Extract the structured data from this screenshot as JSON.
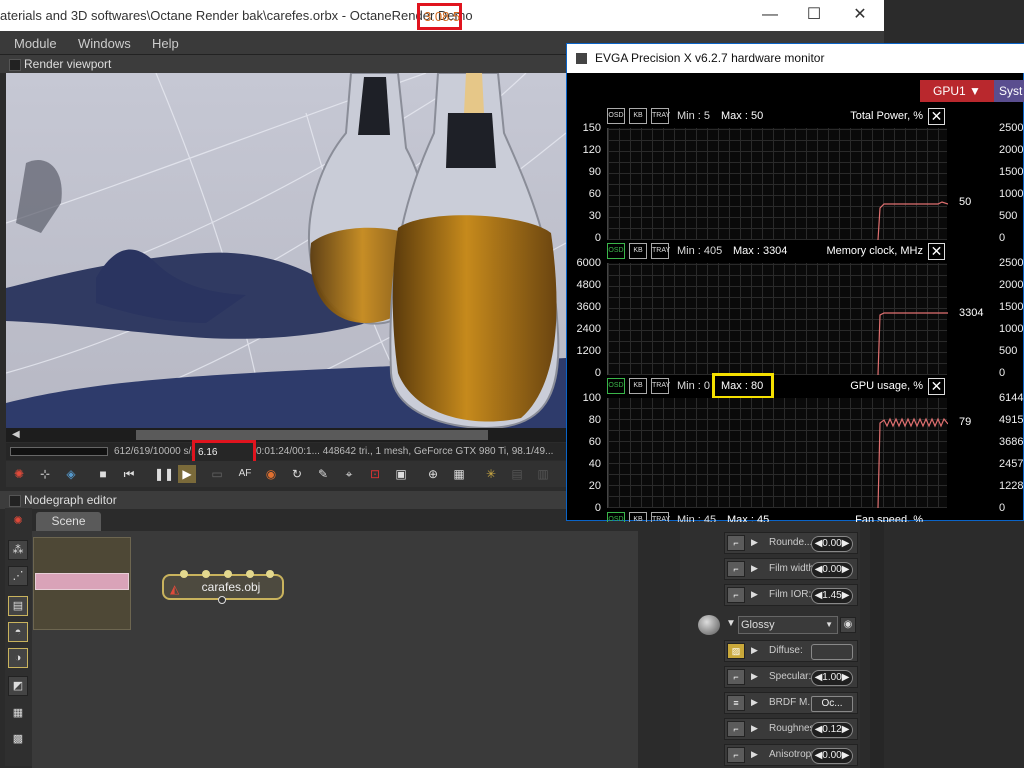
{
  "app": {
    "title_prefix": "aterials and 3D softwares\\Octane Render bak\\carefes.orbx - OctaneRender Demo",
    "version": "3.08.5",
    "window_controls": {
      "minimize": "—",
      "maximize": "☐",
      "close": "✕"
    }
  },
  "menu": [
    "Module",
    "Windows",
    "Help"
  ],
  "viewport": {
    "title": "Render viewport",
    "status_left": "612/619/10000 s/px",
    "speed": "6.16 Ms/sec,",
    "status_right": "0:01:24/00:1... 448642 tri., 1 mesh, GeForce GTX 980 Ti, 98.1/49...",
    "toolbar_icons": [
      "octane-logo-icon",
      "recenter-icon",
      "cube-icon",
      "stop-icon",
      "rewind-icon",
      "pause-icon",
      "play-icon",
      "monitor-icon",
      "autofocus-icon",
      "color-picker-icon",
      "rotate-icon",
      "material-picker-icon",
      "object-picker-icon",
      "camera-target-icon",
      "region-icon",
      "zoom-icon",
      "film-region-icon",
      "locked-icon",
      "lock-icon",
      "grid-icon"
    ]
  },
  "nodegraph": {
    "title": "Nodegraph editor",
    "tab": "Scene",
    "node_label": "carafes.obj"
  },
  "material": {
    "rows": [
      {
        "label": "Rounde...",
        "value": "0.00"
      },
      {
        "label": "Film width:",
        "value": "0.00"
      },
      {
        "label": "Film IOR:",
        "value": "1.45"
      }
    ],
    "glossy_label": "Glossy",
    "glossy_rows": [
      {
        "label": "Diffuse:",
        "value": ""
      },
      {
        "label": "Specular:",
        "value": "1.00"
      },
      {
        "label": "BRDF M...",
        "value": "Oc..."
      },
      {
        "label": "Roughness:",
        "value": "0.12"
      },
      {
        "label": "Anisotropy:",
        "value": "0.00"
      }
    ]
  },
  "monitor": {
    "title": "EVGA Precision X v6.2.7 hardware monitor",
    "gpu_button": "GPU1 ▼",
    "sys_button": "Syst",
    "osd_labels": [
      "OSD",
      "KB LCD",
      "TRAY"
    ],
    "graphs": [
      {
        "name": "Total Power, %",
        "min": "Min : 5",
        "max": "Max : 50",
        "current": "50",
        "yticks": [
          "150",
          "120",
          "90",
          "60",
          "30",
          "0"
        ],
        "osd_on": false
      },
      {
        "name": "Memory clock, MHz",
        "min": "Min : 405",
        "max": "Max : 3304",
        "current": "3304",
        "yticks": [
          "6000",
          "4800",
          "3600",
          "2400",
          "1200",
          "0"
        ],
        "osd_on": true
      },
      {
        "name": "GPU usage, %",
        "min": "Min : 0",
        "max": "Max : 80",
        "current": "79",
        "yticks": [
          "100",
          "80",
          "60",
          "40",
          "20",
          "0"
        ],
        "osd_on": true
      },
      {
        "name": "Fan speed, %",
        "min": "Min : 45",
        "max": "Max : 45",
        "current": "",
        "yticks": [],
        "osd_on": true
      }
    ],
    "right_ticks": [
      "2500",
      "2000",
      "1500",
      "1000",
      "500",
      "0",
      "2500",
      "2000",
      "1500",
      "1000",
      "500",
      "0",
      "6144",
      "4915",
      "3686",
      "2457",
      "1228",
      "0"
    ]
  }
}
